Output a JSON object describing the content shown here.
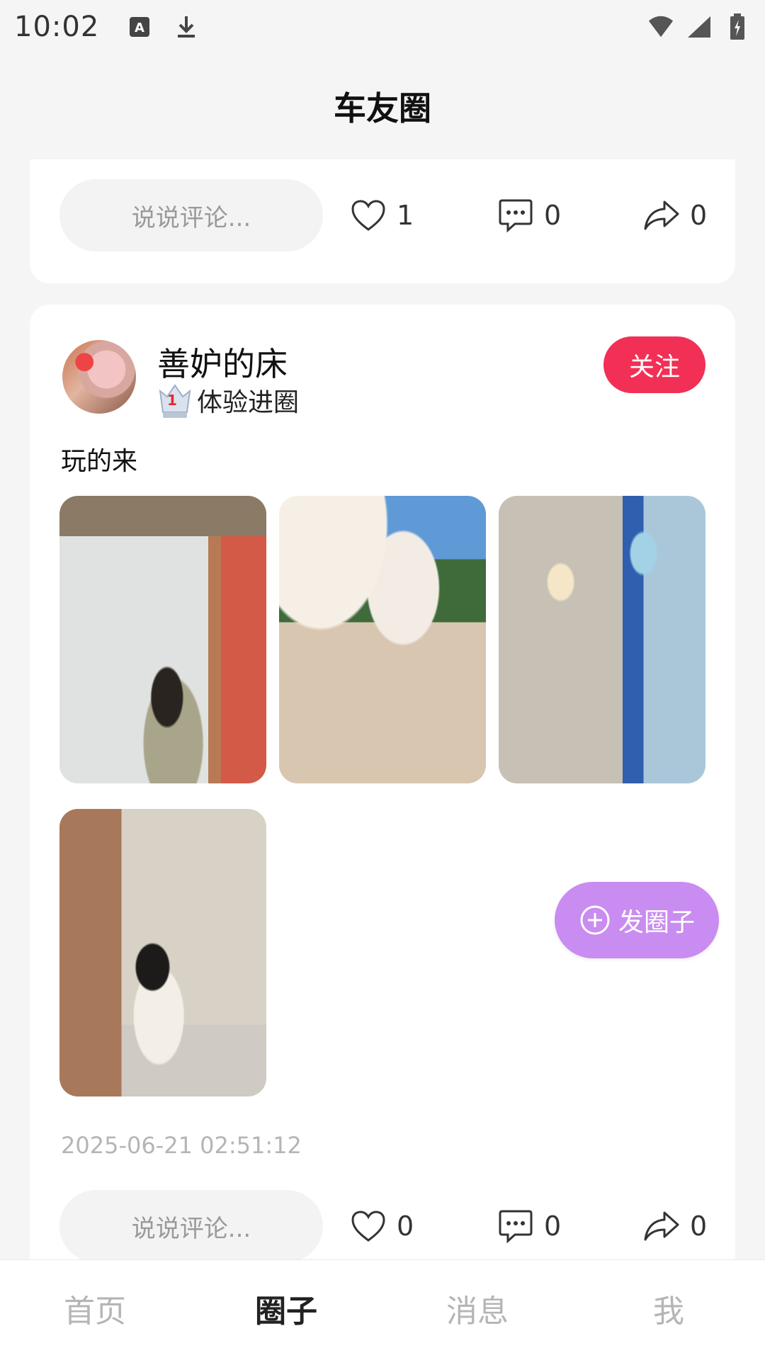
{
  "status_bar": {
    "time": "10:02",
    "icons_left": [
      "keyboard-a-icon",
      "download-icon"
    ],
    "icons_right": [
      "wifi-icon",
      "cell-signal-icon",
      "battery-charging-icon"
    ]
  },
  "header": {
    "title": "车友圈"
  },
  "top_card": {
    "comment_placeholder": "说说评论...",
    "likes": "1",
    "comments": "0",
    "shares": "0"
  },
  "post": {
    "username": "善妒的床",
    "badge_text": "体验进圈",
    "badge_number": "1",
    "follow_label": "关注",
    "text": "玩的来",
    "timestamp": "2025-06-21 02:51:12",
    "comment_placeholder": "说说评论...",
    "likes": "0",
    "comments": "0",
    "shares": "0"
  },
  "fab": {
    "label": "发圈子"
  },
  "bottom_nav": {
    "items": [
      {
        "label": "首页"
      },
      {
        "label": "圈子"
      },
      {
        "label": "消息"
      },
      {
        "label": "我"
      }
    ],
    "active_index": 1
  },
  "colors": {
    "accent_follow": "#f22f55",
    "fab": "#c98cf0",
    "background": "#f5f5f5"
  }
}
